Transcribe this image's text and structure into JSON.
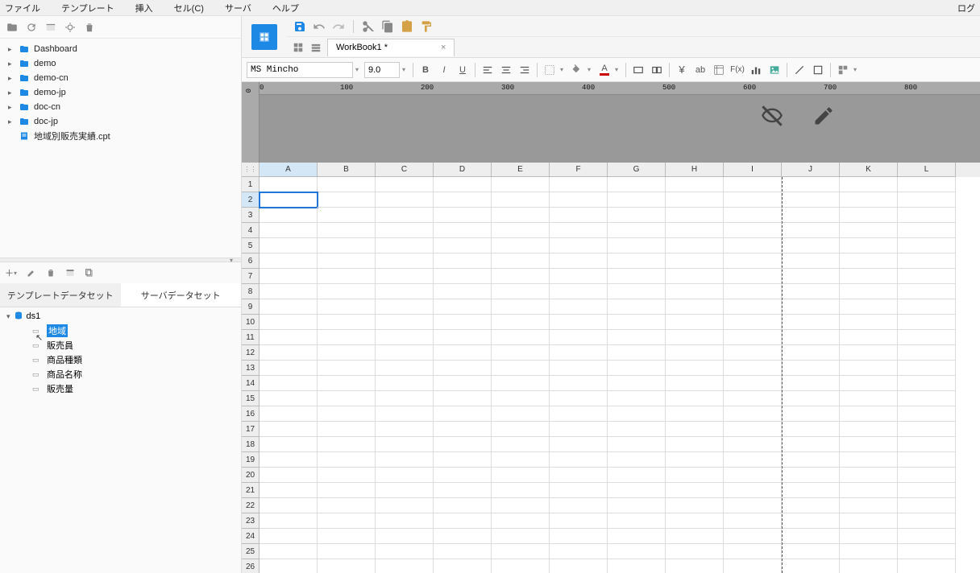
{
  "menu": {
    "file": "ファイル",
    "template": "テンプレート",
    "insert": "挿入",
    "cell": "セル(C)",
    "server": "サーバ",
    "help": "ヘルプ",
    "login": "ログ"
  },
  "file_tree": [
    {
      "label": "Dashboard",
      "type": "folder"
    },
    {
      "label": "demo",
      "type": "folder"
    },
    {
      "label": "demo-cn",
      "type": "folder"
    },
    {
      "label": "demo-jp",
      "type": "folder"
    },
    {
      "label": "doc-cn",
      "type": "folder"
    },
    {
      "label": "doc-jp",
      "type": "folder"
    },
    {
      "label": "地域別販売実績.cpt",
      "type": "file"
    }
  ],
  "dataset": {
    "tabs": {
      "template": "テンプレートデータセット",
      "server": "サーバデータセット"
    },
    "root": "ds1",
    "fields": [
      {
        "label": "地域",
        "selected": true
      },
      {
        "label": "販売員",
        "selected": false
      },
      {
        "label": "商品種類",
        "selected": false
      },
      {
        "label": "商品名称",
        "selected": false
      },
      {
        "label": "販売量",
        "selected": false
      }
    ]
  },
  "editor": {
    "font": "MS Mincho",
    "size": "9.0",
    "tab_title": "WorkBook1 *",
    "columns": [
      "A",
      "B",
      "C",
      "D",
      "E",
      "F",
      "G",
      "H",
      "I",
      "J",
      "K",
      "L"
    ],
    "row_count": 26,
    "selected_cell": {
      "col": 0,
      "row": 1
    },
    "ruler_marks": [
      0,
      100,
      200,
      300,
      400,
      500,
      600,
      700,
      800
    ],
    "ruler_v": [
      0
    ],
    "pagebreak_col": 9
  }
}
